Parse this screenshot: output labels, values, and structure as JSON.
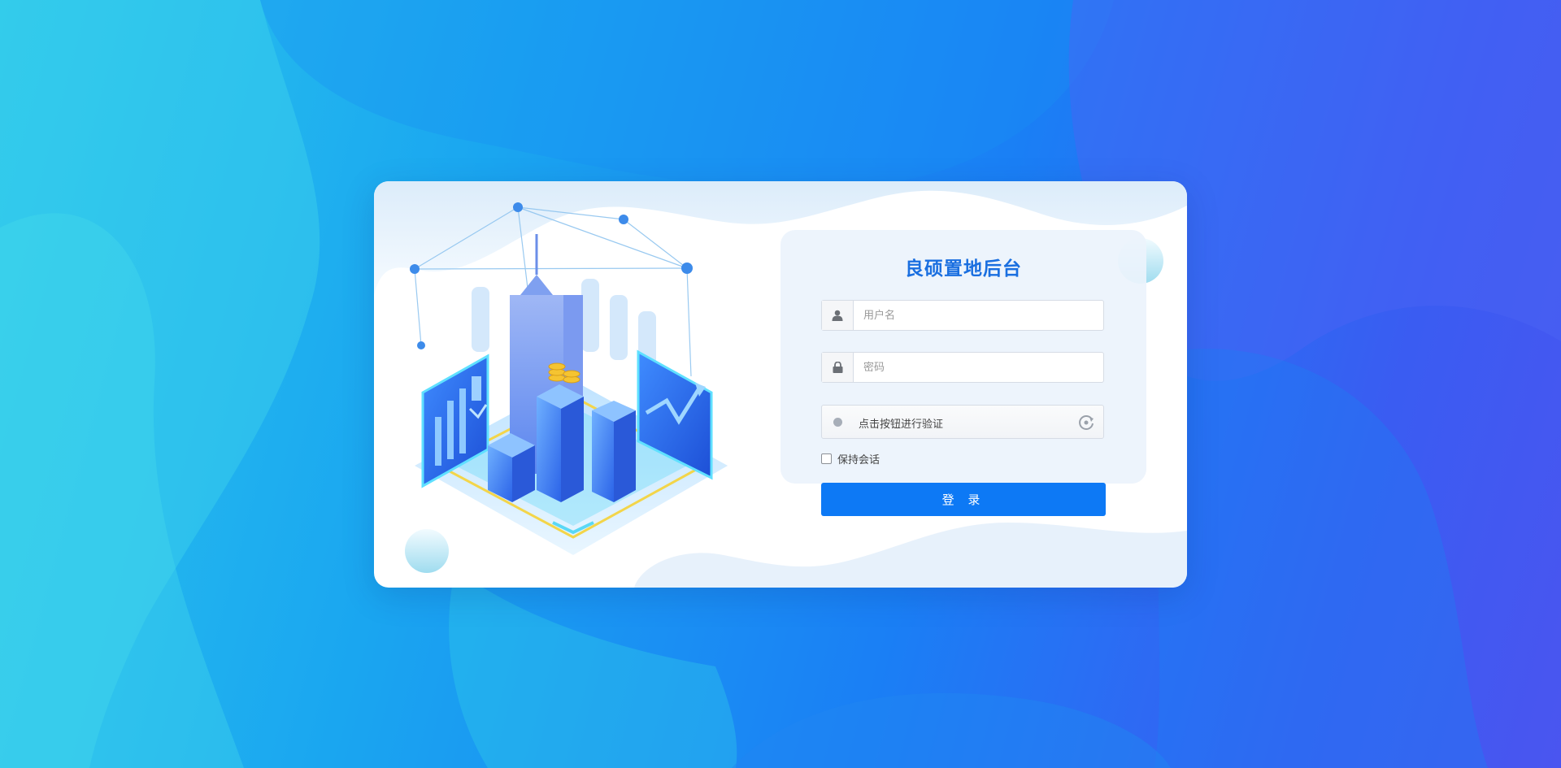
{
  "app": {
    "title": "良硕置地后台"
  },
  "form": {
    "username_placeholder": "用户名",
    "password_placeholder": "密码",
    "captcha_label": "点击按钮进行验证",
    "remember_label": "保持会话",
    "login_label": "登 录"
  },
  "icons": {
    "username": "user-icon",
    "password": "lock-icon",
    "captcha_status": "dot-icon",
    "captcha_refresh": "refresh-icon",
    "illustration": "city-dashboard-illustration"
  },
  "colors": {
    "primary": "#0d79f5",
    "title": "#1a6fe0",
    "background_start": "#2bc6ec",
    "background_end": "#4a55f0"
  }
}
